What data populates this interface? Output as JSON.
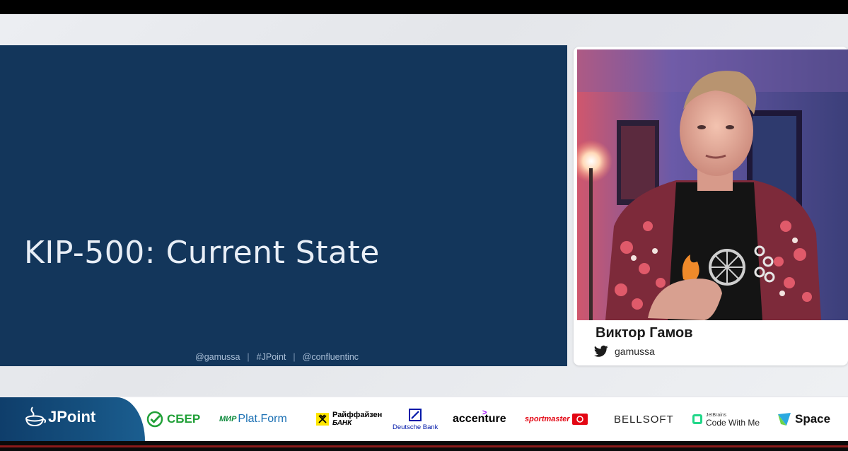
{
  "slide": {
    "title": "KIP-500: Current State",
    "footer": [
      "@gamussa",
      "#JPoint",
      "@confluentinc"
    ]
  },
  "speaker": {
    "name": "Виктор Гамов",
    "twitter_handle": "gamussa"
  },
  "event": {
    "name": "JPoint"
  },
  "sponsors": [
    {
      "name": "СБЕР"
    },
    {
      "name_a": "МИР",
      "name_b": "Plat.Form"
    },
    {
      "name_a": "Райффайзен",
      "name_b": "БАНК"
    },
    {
      "name": "Deutsche Bank"
    },
    {
      "name": "accenture"
    },
    {
      "name": "sportmaster"
    },
    {
      "name": "BELLSOFT"
    },
    {
      "name_a": "JetBrains",
      "name_b": "Code With Me"
    },
    {
      "name": "Space"
    }
  ],
  "colors": {
    "slide_bg": "#13365b",
    "sber_green": "#21a038",
    "jpoint_blue": "#15507f",
    "twitter": "#1b1b1b"
  }
}
